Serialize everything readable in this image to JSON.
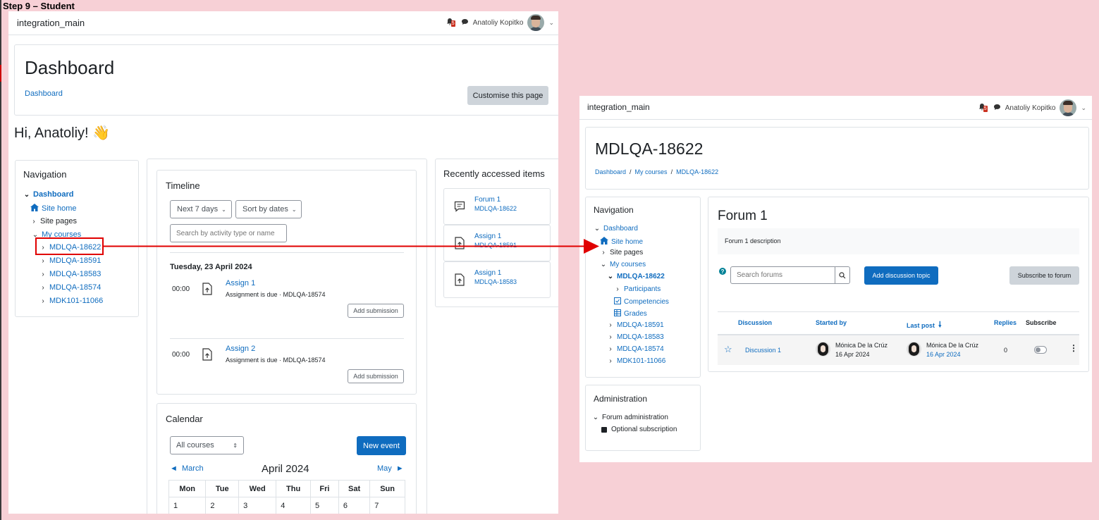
{
  "step_label": "Step 9 – Student",
  "left": {
    "site_name": "integration_main",
    "notification_count": "5",
    "user_name": "Anatoliy Kopitko",
    "page_title": "Dashboard",
    "breadcrumb": "Dashboard",
    "customise_label": "Customise this page",
    "greeting": "Hi, Anatoliy! 👋",
    "navigation": {
      "title": "Navigation",
      "dashboard": "Dashboard",
      "site_home": "Site home",
      "site_pages": "Site pages",
      "my_courses": "My courses",
      "courses": [
        "MDLQA-18622",
        "MDLQA-18591",
        "MDLQA-18583",
        "MDLQA-18574",
        "MDK101-11066"
      ]
    },
    "timeline": {
      "title": "Timeline",
      "filter_label": "Next 7 days",
      "sort_label": "Sort by dates",
      "search_placeholder": "Search by activity type or name",
      "date_heading": "Tuesday, 23 April 2024",
      "items": [
        {
          "time": "00:00",
          "name": "Assign 1",
          "desc": "Assignment is due · MDLQA-18574",
          "action": "Add submission"
        },
        {
          "time": "00:00",
          "name": "Assign 2",
          "desc": "Assignment is due · MDLQA-18574",
          "action": "Add submission"
        }
      ]
    },
    "calendar": {
      "title": "Calendar",
      "course_filter": "All courses",
      "new_event": "New event",
      "prev": "◄  March",
      "month": "April 2024",
      "next": "May  ►",
      "weekdays": [
        "Mon",
        "Tue",
        "Wed",
        "Thu",
        "Fri",
        "Sat",
        "Sun"
      ],
      "first_week": [
        "1",
        "2",
        "3",
        "4",
        "5",
        "6",
        "7"
      ]
    },
    "recent": {
      "title": "Recently accessed items",
      "items": [
        {
          "name": "Forum 1",
          "course": "MDLQA-18622",
          "icon": "forum-icon"
        },
        {
          "name": "Assign 1",
          "course": "MDLQA-18591",
          "icon": "assignment-icon"
        },
        {
          "name": "Assign 1",
          "course": "MDLQA-18583",
          "icon": "assignment-icon"
        }
      ]
    }
  },
  "right": {
    "site_name": "integration_main",
    "notification_count": "5",
    "user_name": "Anatoliy Kopitko",
    "course_title": "MDLQA-18622",
    "breadcrumbs": [
      "Dashboard",
      "/",
      "My courses",
      "/",
      "MDLQA-18622"
    ],
    "navigation": {
      "title": "Navigation",
      "dashboard": "Dashboard",
      "site_home": "Site home",
      "site_pages": "Site pages",
      "my_courses": "My courses",
      "current_course": "MDLQA-18622",
      "course_children": [
        "Participants",
        "Competencies",
        "Grades"
      ],
      "other_courses": [
        "MDLQA-18591",
        "MDLQA-18583",
        "MDLQA-18574",
        "MDK101-11066"
      ]
    },
    "administration": {
      "title": "Administration",
      "forum_admin": "Forum administration",
      "optional_sub": "Optional subscription"
    },
    "forum": {
      "title": "Forum 1",
      "description": "Forum 1 description",
      "search_placeholder": "Search forums",
      "add_topic": "Add discussion topic",
      "subscribe": "Subscribe to forum",
      "columns": {
        "discussion": "Discussion",
        "started_by": "Started by",
        "last_post": "Last post",
        "replies": "Replies",
        "subscribe": "Subscribe"
      },
      "rows": [
        {
          "discussion": "Discussion 1",
          "starter": "Mónica De la Crúz",
          "start_date": "16 Apr 2024",
          "last_author": "Mónica De la Crúz",
          "last_date": "16 Apr 2024",
          "replies": "0"
        }
      ]
    }
  },
  "colors": {
    "link": "#0f6cbf",
    "annotation": "#e00000",
    "background": "#f7d0d6"
  }
}
